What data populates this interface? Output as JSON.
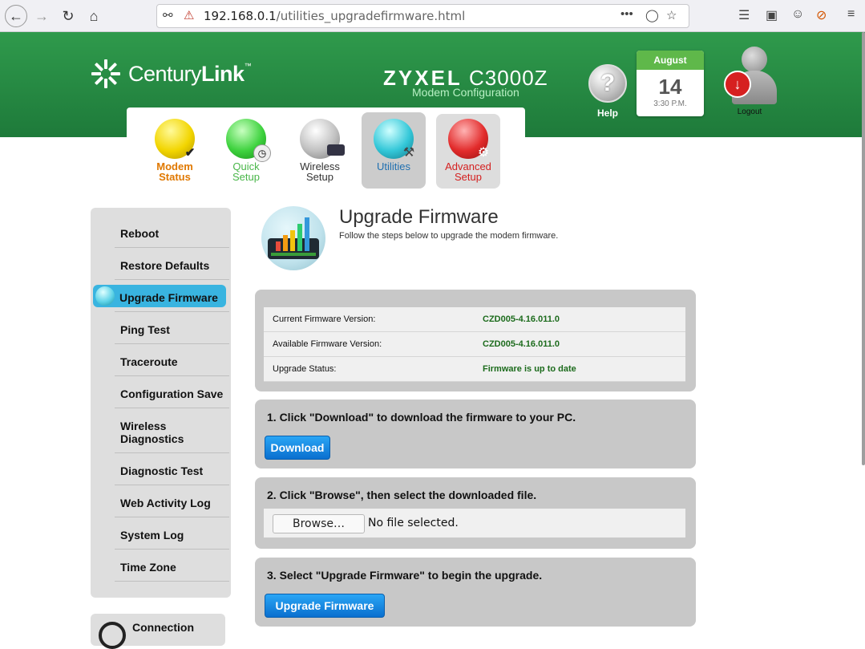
{
  "browser": {
    "url_host": "192.168.0.1",
    "url_path": "/utilities_upgradefirmware.html",
    "more_label": "•••"
  },
  "header": {
    "brand_prefix": "Century",
    "brand_bold": "Link",
    "brand_tm": "™",
    "model_brand": "ZYXEL",
    "model_name": "C3000Z",
    "model_sub": "Modem Configuration",
    "help_label": "Help",
    "help_glyph": "?",
    "calendar": {
      "month": "August",
      "day": "14",
      "time": "3:30 P.M."
    },
    "logout_label": "Logout"
  },
  "tabs": [
    {
      "line1": "Modem",
      "line2": "Status",
      "color": "#e07800",
      "icon": "modem-status-icon"
    },
    {
      "line1": "Quick",
      "line2": "Setup",
      "color": "#49b649",
      "icon": "quick-setup-icon"
    },
    {
      "line1": "Wireless",
      "line2": "Setup",
      "color": "#333333",
      "icon": "wireless-setup-icon"
    },
    {
      "line1": "Utilities",
      "line2": "",
      "color": "#1f6fb0",
      "icon": "utilities-icon"
    },
    {
      "line1": "Advanced",
      "line2": "Setup",
      "color": "#d42020",
      "icon": "advanced-setup-icon"
    }
  ],
  "sidebar": {
    "items": [
      {
        "label": "Reboot"
      },
      {
        "label": "Restore Defaults"
      },
      {
        "label": "Upgrade Firmware",
        "active": true
      },
      {
        "label": "Ping Test"
      },
      {
        "label": "Traceroute"
      },
      {
        "label": "Configuration Save"
      },
      {
        "label": "Wireless",
        "label2": "Diagnostics"
      },
      {
        "label": "Diagnostic Test"
      },
      {
        "label": "Web Activity Log"
      },
      {
        "label": "System Log"
      },
      {
        "label": "Time Zone"
      }
    ],
    "connection_label": "Connection"
  },
  "main": {
    "title": "Upgrade Firmware",
    "subtitle": "Follow the steps below to upgrade the modem firmware.",
    "info": [
      {
        "key": "Current Firmware Version:",
        "value": "CZD005-4.16.011.0"
      },
      {
        "key": "Available Firmware Version:",
        "value": "CZD005-4.16.011.0"
      },
      {
        "key": "Upgrade Status:",
        "value": "Firmware is up to date"
      }
    ],
    "step1": "1. Click \"Download\" to download the firmware to your PC.",
    "download_label": "Download",
    "step2": "2. Click \"Browse\", then select the downloaded file.",
    "browse_label": "Browse…",
    "file_status": "No file selected.",
    "step3": "3. Select \"Upgrade Firmware\" to begin the upgrade.",
    "upgrade_label": "Upgrade Firmware"
  }
}
